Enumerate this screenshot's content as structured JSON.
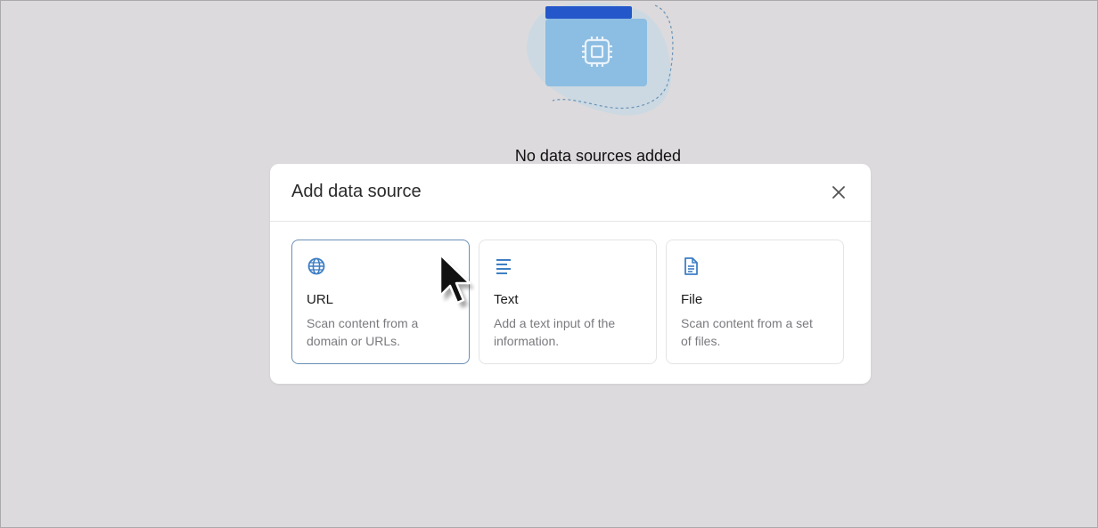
{
  "empty_state": {
    "title": "No data sources added"
  },
  "modal": {
    "title": "Add data source",
    "options": [
      {
        "label": "URL",
        "description_line1": "Scan content from a",
        "description_line2": "domain or URLs.",
        "icon": "globe-icon",
        "selected": true
      },
      {
        "label": "Text",
        "description_line1": "Add a text input of the",
        "description_line2": "information.",
        "icon": "text-lines-icon",
        "selected": false
      },
      {
        "label": "File",
        "description_line1": "Scan content from a set",
        "description_line2": "of files.",
        "icon": "document-icon",
        "selected": false
      }
    ]
  },
  "colors": {
    "accent": "#3f7fc4",
    "background": "#dcdadc",
    "illustration_folder": "#8cbde2",
    "illustration_tab": "#2457c9"
  }
}
